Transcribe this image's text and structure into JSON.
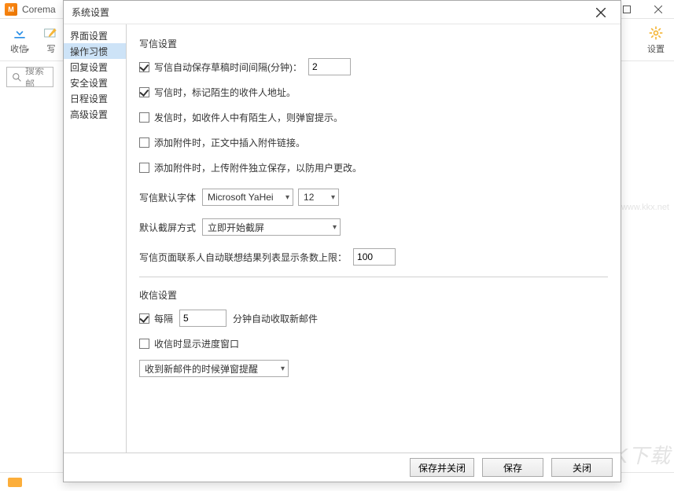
{
  "main": {
    "app_label": "M",
    "title": "Corema",
    "toolbar": {
      "receive_label": "收信",
      "write_label": "写",
      "settings_label": "设置"
    },
    "search_placeholder": "搜索邮",
    "watermark_small": "www.kkx.net",
    "watermark_big": "KK下载"
  },
  "dialog": {
    "title": "系统设置",
    "tabs": [
      "界面设置",
      "操作习惯",
      "回复设置",
      "安全设置",
      "日程设置",
      "高级设置"
    ],
    "selected_tab_index": 1,
    "write_section_title": "写信设置",
    "opt_autosave_label": "写信自动保存草稿时间间隔(分钟)：",
    "opt_autosave_checked": true,
    "opt_autosave_value": "2",
    "opt_mark_stranger_label": "写信时，标记陌生的收件人地址。",
    "opt_mark_stranger_checked": true,
    "opt_send_stranger_label": "发信时，如收件人中有陌生人，则弹窗提示。",
    "opt_send_stranger_checked": false,
    "opt_attach_link_label": "添加附件时，正文中插入附件链接。",
    "opt_attach_link_checked": false,
    "opt_attach_save_label": "添加附件时，上传附件独立保存，以防用户更改。",
    "opt_attach_save_checked": false,
    "font_label": "写信默认字体",
    "font_value": "Microsoft YaHei",
    "font_size_value": "12",
    "screenshot_label": "默认截屏方式",
    "screenshot_value": "立即开始截屏",
    "contact_limit_label": "写信页面联系人自动联想结果列表显示条数上限：",
    "contact_limit_value": "100",
    "receive_section_title": "收信设置",
    "recv_interval_prefix": "每隔",
    "recv_interval_checked": true,
    "recv_interval_value": "5",
    "recv_interval_suffix": "分钟自动收取新邮件",
    "recv_progress_label": "收信时显示进度窗口",
    "recv_progress_checked": false,
    "recv_action_value": "收到新邮件的时候弹窗提醒",
    "footer": {
      "save_close": "保存并关闭",
      "save": "保存",
      "close": "关闭"
    }
  }
}
